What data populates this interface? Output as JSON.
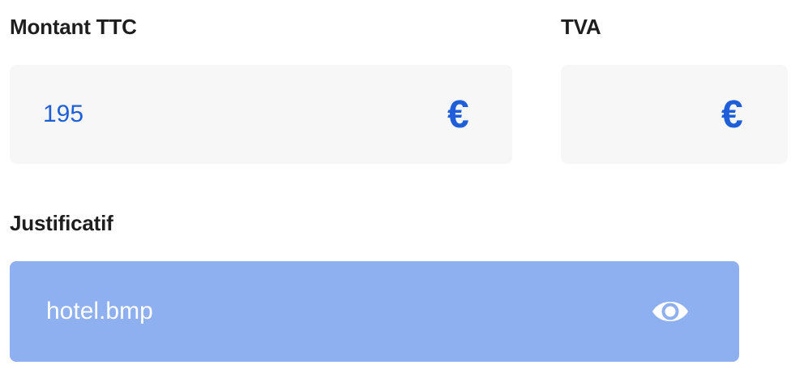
{
  "amount_field": {
    "label": "Montant TTC",
    "value": "195",
    "currency_symbol": "€"
  },
  "vat_field": {
    "label": "TVA",
    "value": "",
    "currency_symbol": "€"
  },
  "attachment": {
    "label": "Justificatif",
    "file_name": "hotel.bmp",
    "icon": "eye-icon"
  },
  "colors": {
    "accent": "#1e5fd9",
    "input_background": "#f7f7f7",
    "file_background": "#8eaff0",
    "label_text": "#1e1e1e"
  }
}
